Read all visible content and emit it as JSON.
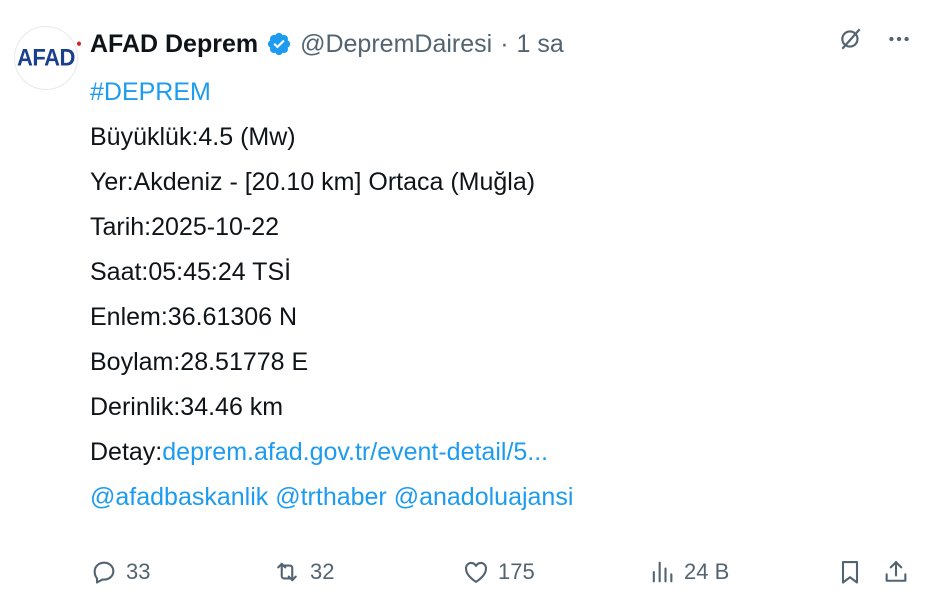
{
  "tweet": {
    "avatar_text": "AFAD",
    "display_name": "AFAD Deprem",
    "handle": "@DepremDairesi",
    "separator": "·",
    "time": "1 sa",
    "hashtag": "#DEPREM",
    "lines": [
      "Büyüklük:4.5 (Mw)",
      "Yer:Akdeniz - [20.10 km] Ortaca (Muğla)",
      "Tarih:2025-10-22",
      "Saat:05:45:24 TSİ",
      "Enlem:36.61306 N",
      "Boylam:28.51778 E",
      "Derinlik:34.46 km"
    ],
    "detail_label": "Detay:",
    "detail_link": "deprem.afad.gov.tr/event-detail/5...",
    "mentions": [
      "@afadbaskanlik",
      "@trthaber",
      "@anadoluajansi"
    ]
  },
  "actions": {
    "replies": "33",
    "reposts": "32",
    "likes": "175",
    "views": "24 B"
  },
  "colors": {
    "link": "#1d9bf0",
    "muted": "#536471",
    "text": "#0f1419",
    "verified": "#1d9bf0"
  },
  "icons": [
    "grok-icon",
    "more-icon",
    "reply-icon",
    "repost-icon",
    "like-icon",
    "views-icon",
    "bookmark-icon",
    "share-icon",
    "verified-badge-icon"
  ]
}
